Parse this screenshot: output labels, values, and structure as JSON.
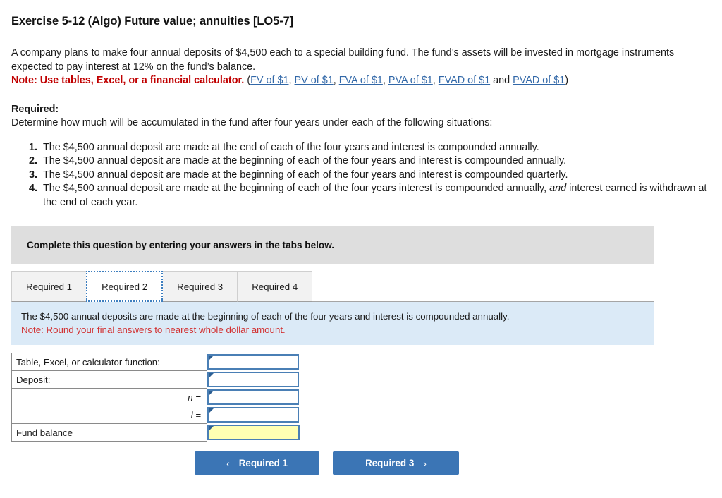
{
  "exercise": {
    "title": "Exercise 5-12 (Algo) Future value; annuities [LO5-7]"
  },
  "intro": {
    "paragraph_part1": "A company plans to make four annual deposits of $4,500 each to a special building fund. The fund’s assets will be invested in mortgage instruments expected to pay interest at 12% on the fund’s balance.",
    "note_label": "Note: Use tables, Excel, or a financial calculator.",
    "links_open": "(",
    "links": [
      {
        "label": "FV of $1",
        "sep": ", "
      },
      {
        "label": "PV of $1",
        "sep": ", "
      },
      {
        "label": "FVA of $1",
        "sep": ", "
      },
      {
        "label": "PVA of $1",
        "sep": ", "
      },
      {
        "label": "FVAD of $1",
        "sep": " and "
      },
      {
        "label": "PVAD of $1",
        "sep": ")"
      }
    ]
  },
  "required": {
    "heading": "Required:",
    "subtext": "Determine how much will be accumulated in the fund after four years under each of the following situations:",
    "situations": [
      "The $4,500 annual deposit are made at the end of each of the four years  and interest is compounded annually.",
      "The $4,500 annual deposit are made at the beginning of each of the four years and interest is compounded annually.",
      "The $4,500 annual deposit are made at the beginning of each of the four years and interest is compounded quarterly.",
      "The $4,500 annual deposit are made at the beginning of each of the four years interest is compounded annually, "
    ],
    "situation4_italic": "and",
    "situation4_tail": " interest earned is withdrawn at the end of each year."
  },
  "instruction_bar": {
    "text": "Complete this question by entering your answers in the tabs below."
  },
  "tabs": [
    {
      "label": "Required 1",
      "active": false
    },
    {
      "label": "Required 2",
      "active": true
    },
    {
      "label": "Required 3",
      "active": false
    },
    {
      "label": "Required 4",
      "active": false
    }
  ],
  "blue_panel": {
    "description": "The $4,500 annual deposits are made at the beginning of each of the four years and interest is compounded annually.",
    "note": "Note: Round your final answers to nearest whole dollar amount."
  },
  "answer_table": {
    "rows": [
      {
        "label": "Table, Excel, or calculator function:",
        "align": "left",
        "value": "",
        "highlight": false
      },
      {
        "label": "Deposit:",
        "align": "left",
        "value": "",
        "highlight": false
      },
      {
        "label": "n =",
        "align": "right",
        "value": "",
        "highlight": false
      },
      {
        "label": "i =",
        "align": "right",
        "value": "",
        "highlight": false
      },
      {
        "label": "Fund balance",
        "align": "left",
        "value": "",
        "highlight": true
      }
    ]
  },
  "nav": {
    "prev_label": "Required 1",
    "next_label": "Required 3",
    "prev_icon": "chevron-left-icon",
    "next_icon": "chevron-right-icon",
    "prev_chevron": "‹",
    "next_chevron": "›"
  },
  "colors": {
    "accent_blue": "#3b75b5",
    "note_red": "#c00000",
    "panel_blue": "#dbeaf7",
    "instruction_gray": "#dedede",
    "highlight_yellow": "#ffffb3"
  }
}
